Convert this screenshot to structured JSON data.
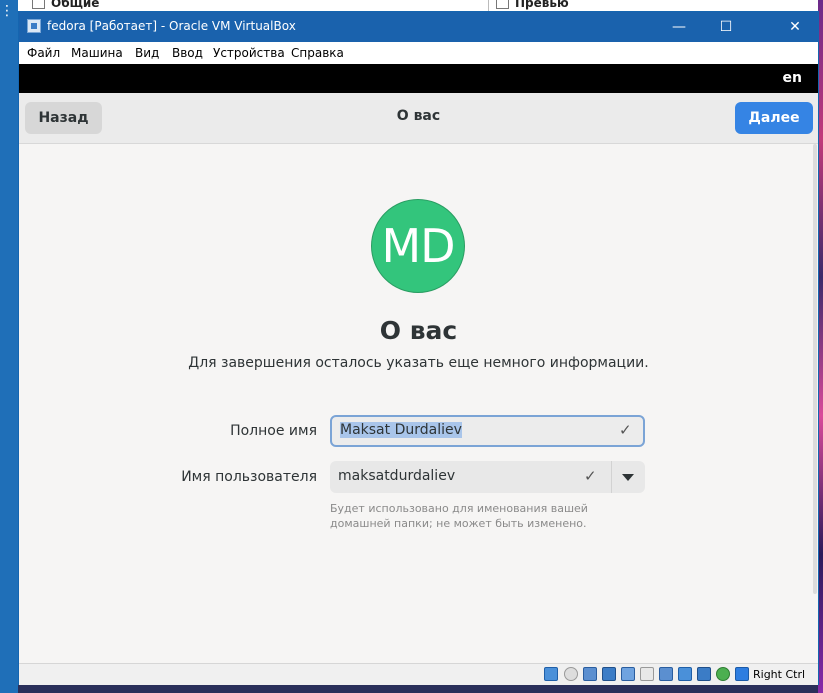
{
  "background": {
    "items": [
      "Общие",
      "Превью"
    ]
  },
  "window": {
    "title": "fedora [Работает] - Oracle VM VirtualBox",
    "controls": {
      "minimize": "—",
      "maximize": "☐",
      "close": "✕"
    },
    "menu": [
      "Файл",
      "Машина",
      "Вид",
      "Ввод",
      "Устройства",
      "Справка"
    ]
  },
  "guest": {
    "topbar": {
      "lang": "en"
    },
    "header": {
      "back_label": "Назад",
      "title": "О вас",
      "next_label": "Далее"
    },
    "avatar": {
      "initials": "MD",
      "color": "#33c57c"
    },
    "page": {
      "title": "О вас",
      "subtitle": "Для завершения осталось указать еще немного информации."
    },
    "form": {
      "full_name": {
        "label": "Полное имя",
        "value": "Maksat Durdaliev"
      },
      "username": {
        "label": "Имя пользователя",
        "value": "maksatdurdaliev"
      },
      "hint": "Будет использовано для именования вашей домашней папки; не может быть изменено."
    }
  },
  "statusbar": {
    "host_key": "Right Ctrl",
    "icons": [
      "hard-disk-icon",
      "optical-drive-icon",
      "audio-icon",
      "network-icon",
      "usb-icon",
      "shared-folders-icon",
      "display-icon",
      "recording-icon",
      "cpu-icon",
      "mouse-integration-icon",
      "host-key-icon"
    ]
  },
  "colors": {
    "accent": "#3584e4",
    "titlebar": "#1a62ad"
  }
}
